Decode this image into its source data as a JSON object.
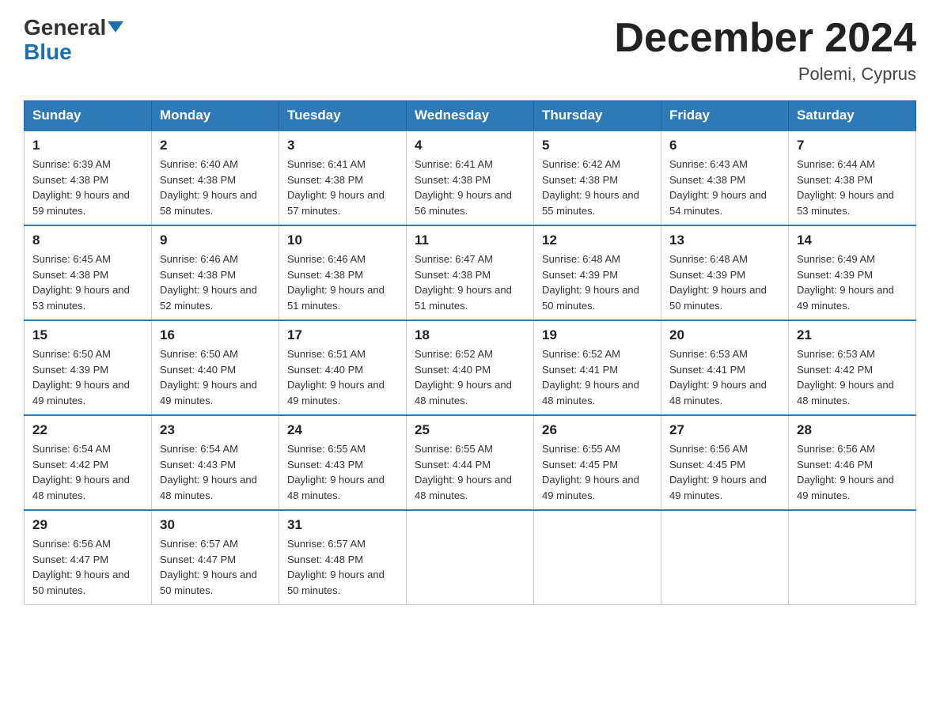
{
  "header": {
    "logo_general": "General",
    "logo_blue": "Blue",
    "month_title": "December 2024",
    "location": "Polemi, Cyprus"
  },
  "days_of_week": [
    "Sunday",
    "Monday",
    "Tuesday",
    "Wednesday",
    "Thursday",
    "Friday",
    "Saturday"
  ],
  "weeks": [
    [
      {
        "day": "1",
        "sunrise": "6:39 AM",
        "sunset": "4:38 PM",
        "daylight": "9 hours and 59 minutes."
      },
      {
        "day": "2",
        "sunrise": "6:40 AM",
        "sunset": "4:38 PM",
        "daylight": "9 hours and 58 minutes."
      },
      {
        "day": "3",
        "sunrise": "6:41 AM",
        "sunset": "4:38 PM",
        "daylight": "9 hours and 57 minutes."
      },
      {
        "day": "4",
        "sunrise": "6:41 AM",
        "sunset": "4:38 PM",
        "daylight": "9 hours and 56 minutes."
      },
      {
        "day": "5",
        "sunrise": "6:42 AM",
        "sunset": "4:38 PM",
        "daylight": "9 hours and 55 minutes."
      },
      {
        "day": "6",
        "sunrise": "6:43 AM",
        "sunset": "4:38 PM",
        "daylight": "9 hours and 54 minutes."
      },
      {
        "day": "7",
        "sunrise": "6:44 AM",
        "sunset": "4:38 PM",
        "daylight": "9 hours and 53 minutes."
      }
    ],
    [
      {
        "day": "8",
        "sunrise": "6:45 AM",
        "sunset": "4:38 PM",
        "daylight": "9 hours and 53 minutes."
      },
      {
        "day": "9",
        "sunrise": "6:46 AM",
        "sunset": "4:38 PM",
        "daylight": "9 hours and 52 minutes."
      },
      {
        "day": "10",
        "sunrise": "6:46 AM",
        "sunset": "4:38 PM",
        "daylight": "9 hours and 51 minutes."
      },
      {
        "day": "11",
        "sunrise": "6:47 AM",
        "sunset": "4:38 PM",
        "daylight": "9 hours and 51 minutes."
      },
      {
        "day": "12",
        "sunrise": "6:48 AM",
        "sunset": "4:39 PM",
        "daylight": "9 hours and 50 minutes."
      },
      {
        "day": "13",
        "sunrise": "6:48 AM",
        "sunset": "4:39 PM",
        "daylight": "9 hours and 50 minutes."
      },
      {
        "day": "14",
        "sunrise": "6:49 AM",
        "sunset": "4:39 PM",
        "daylight": "9 hours and 49 minutes."
      }
    ],
    [
      {
        "day": "15",
        "sunrise": "6:50 AM",
        "sunset": "4:39 PM",
        "daylight": "9 hours and 49 minutes."
      },
      {
        "day": "16",
        "sunrise": "6:50 AM",
        "sunset": "4:40 PM",
        "daylight": "9 hours and 49 minutes."
      },
      {
        "day": "17",
        "sunrise": "6:51 AM",
        "sunset": "4:40 PM",
        "daylight": "9 hours and 49 minutes."
      },
      {
        "day": "18",
        "sunrise": "6:52 AM",
        "sunset": "4:40 PM",
        "daylight": "9 hours and 48 minutes."
      },
      {
        "day": "19",
        "sunrise": "6:52 AM",
        "sunset": "4:41 PM",
        "daylight": "9 hours and 48 minutes."
      },
      {
        "day": "20",
        "sunrise": "6:53 AM",
        "sunset": "4:41 PM",
        "daylight": "9 hours and 48 minutes."
      },
      {
        "day": "21",
        "sunrise": "6:53 AM",
        "sunset": "4:42 PM",
        "daylight": "9 hours and 48 minutes."
      }
    ],
    [
      {
        "day": "22",
        "sunrise": "6:54 AM",
        "sunset": "4:42 PM",
        "daylight": "9 hours and 48 minutes."
      },
      {
        "day": "23",
        "sunrise": "6:54 AM",
        "sunset": "4:43 PM",
        "daylight": "9 hours and 48 minutes."
      },
      {
        "day": "24",
        "sunrise": "6:55 AM",
        "sunset": "4:43 PM",
        "daylight": "9 hours and 48 minutes."
      },
      {
        "day": "25",
        "sunrise": "6:55 AM",
        "sunset": "4:44 PM",
        "daylight": "9 hours and 48 minutes."
      },
      {
        "day": "26",
        "sunrise": "6:55 AM",
        "sunset": "4:45 PM",
        "daylight": "9 hours and 49 minutes."
      },
      {
        "day": "27",
        "sunrise": "6:56 AM",
        "sunset": "4:45 PM",
        "daylight": "9 hours and 49 minutes."
      },
      {
        "day": "28",
        "sunrise": "6:56 AM",
        "sunset": "4:46 PM",
        "daylight": "9 hours and 49 minutes."
      }
    ],
    [
      {
        "day": "29",
        "sunrise": "6:56 AM",
        "sunset": "4:47 PM",
        "daylight": "9 hours and 50 minutes."
      },
      {
        "day": "30",
        "sunrise": "6:57 AM",
        "sunset": "4:47 PM",
        "daylight": "9 hours and 50 minutes."
      },
      {
        "day": "31",
        "sunrise": "6:57 AM",
        "sunset": "4:48 PM",
        "daylight": "9 hours and 50 minutes."
      },
      null,
      null,
      null,
      null
    ]
  ]
}
